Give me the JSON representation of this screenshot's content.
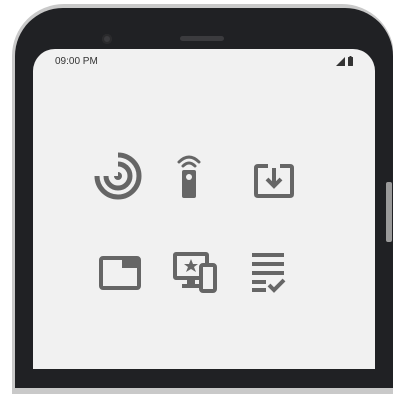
{
  "status_bar": {
    "time": "09:00 PM",
    "icons": [
      "signal-icon",
      "battery-icon"
    ]
  },
  "launcher_icons": [
    {
      "name": "radar-icon"
    },
    {
      "name": "remote-control-icon"
    },
    {
      "name": "download-tray-icon"
    },
    {
      "name": "window-icon"
    },
    {
      "name": "featured-devices-icon"
    },
    {
      "name": "checklist-icon"
    }
  ],
  "colors": {
    "icon": "#666666",
    "screen": "#f1f1f1",
    "bezel": "#202124"
  }
}
